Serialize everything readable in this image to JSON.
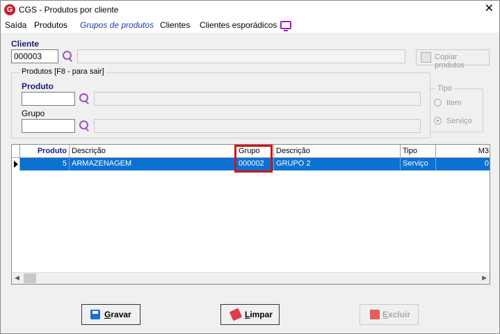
{
  "window": {
    "title": "CGS - Produtos por cliente",
    "app_icon": "G",
    "close": "✕"
  },
  "menu": {
    "items": [
      "Saída",
      "Produtos",
      "Grupos de produtos",
      "Clientes",
      "Clientes esporádicos"
    ],
    "active": "Grupos de produtos"
  },
  "cliente": {
    "label": "Cliente",
    "code": "000003",
    "name": "",
    "copy_button": "Copiar produtos"
  },
  "produtos_group": {
    "title": "Produtos [F8 - para sair]",
    "produto_label": "Produto",
    "produto_value": "",
    "grupo_label": "Grupo",
    "grupo_value": "",
    "tipo": {
      "title": "Tipo",
      "options": [
        "Item",
        "Serviço"
      ],
      "selected": "Serviço"
    }
  },
  "grid": {
    "columns": [
      "Produto",
      "Descrição",
      "Grupo",
      "Descrição",
      "Tipo",
      "M3"
    ],
    "rows": [
      {
        "produto": "5",
        "descricao": "ARMAZENAGEM",
        "grupo": "000002",
        "grupo_descricao": "GRUPO 2",
        "tipo": "Serviço",
        "m3": "0"
      }
    ]
  },
  "buttons": {
    "gravar": {
      "label": "Gravar",
      "hotkey": "G",
      "rest": "ravar"
    },
    "limpar": {
      "label": "Limpar",
      "hotkey": "L",
      "rest": "impar"
    },
    "excluir": {
      "label": "Excluir",
      "hotkey": "E",
      "rest": "xcluir"
    }
  },
  "colors": {
    "selection": "#0b72d2",
    "highlight": "#d0141c",
    "label_blue": "#1b1b7a",
    "active_menu": "#1a3fb0"
  }
}
